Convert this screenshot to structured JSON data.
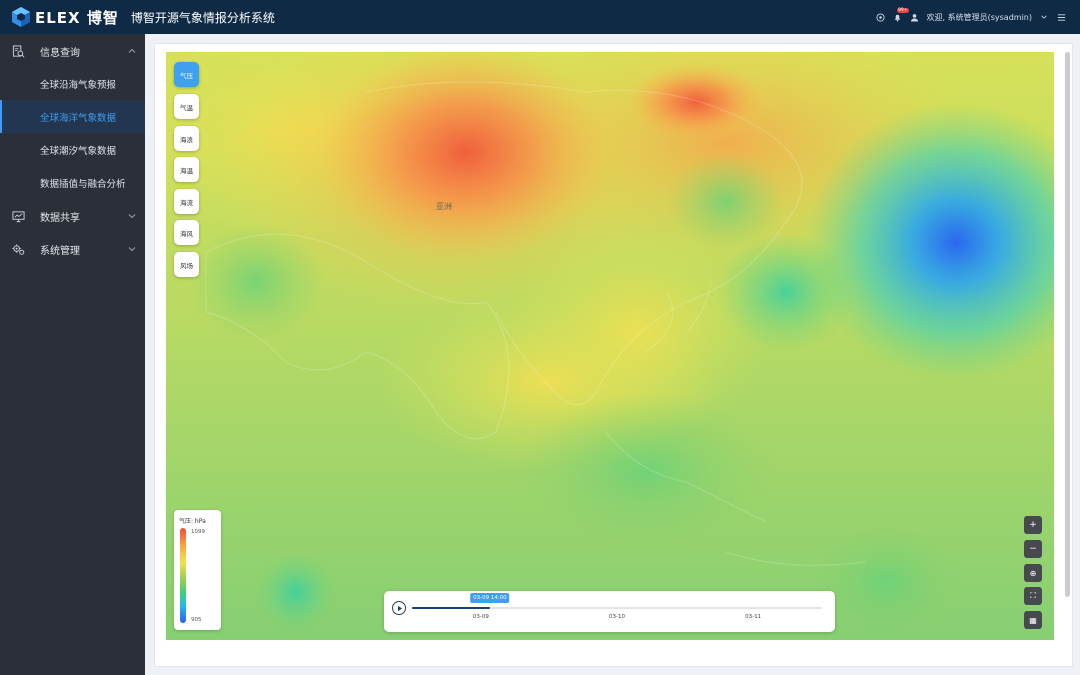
{
  "header": {
    "brand": "ELEX",
    "brand_cn": "博智",
    "app_title": "博智开源气象情报分析系统",
    "notification_badge": "99+",
    "welcome_text": "欢迎, 系统管理员(sysadmin)"
  },
  "sidebar": {
    "groups": [
      {
        "label": "信息查询",
        "icon": "search-doc-icon",
        "expanded": true,
        "items": [
          {
            "label": "全球沿海气象预报",
            "active": false
          },
          {
            "label": "全球海洋气象数据",
            "active": true
          },
          {
            "label": "全球潮汐气象数据",
            "active": false
          },
          {
            "label": "数据插值与融合分析",
            "active": false
          }
        ]
      },
      {
        "label": "数据共享",
        "icon": "monitor-chart-icon",
        "expanded": false
      },
      {
        "label": "系统管理",
        "icon": "gears-icon",
        "expanded": false
      }
    ]
  },
  "layers": [
    {
      "label": "气压",
      "active": true
    },
    {
      "label": "气温",
      "active": false
    },
    {
      "label": "海浪",
      "active": false
    },
    {
      "label": "海温",
      "active": false
    },
    {
      "label": "海流",
      "active": false
    },
    {
      "label": "海风",
      "active": false
    },
    {
      "label": "风场",
      "active": false
    }
  ],
  "map": {
    "region_label": "亚洲"
  },
  "legend": {
    "title": "气压: hPa",
    "max": "1099",
    "min": "905",
    "colors": [
      "#f04a3b",
      "#f7a541",
      "#f5e14c",
      "#8fd04f",
      "#3fd07a",
      "#28b9e2",
      "#2b5ef2"
    ]
  },
  "map_controls": [
    {
      "icon": "zoom-in-icon",
      "glyph": "+"
    },
    {
      "icon": "zoom-out-icon",
      "glyph": "−"
    },
    {
      "icon": "locate-icon",
      "glyph": "⊕"
    },
    {
      "icon": "fullscreen-icon",
      "glyph": "⛶"
    },
    {
      "icon": "grid-icon",
      "glyph": "▦"
    }
  ],
  "timeline": {
    "current_label": "03-09 14:00",
    "progress": 0.19,
    "ticks": [
      {
        "label": "03-09",
        "position": 0.168
      },
      {
        "label": "03-10",
        "position": 0.5
      },
      {
        "label": "03-11",
        "position": 0.832
      }
    ]
  },
  "colors": {
    "accent": "#3f9ff0",
    "header_bg": "#0e2a45",
    "sidebar_bg": "#2b2f38"
  }
}
